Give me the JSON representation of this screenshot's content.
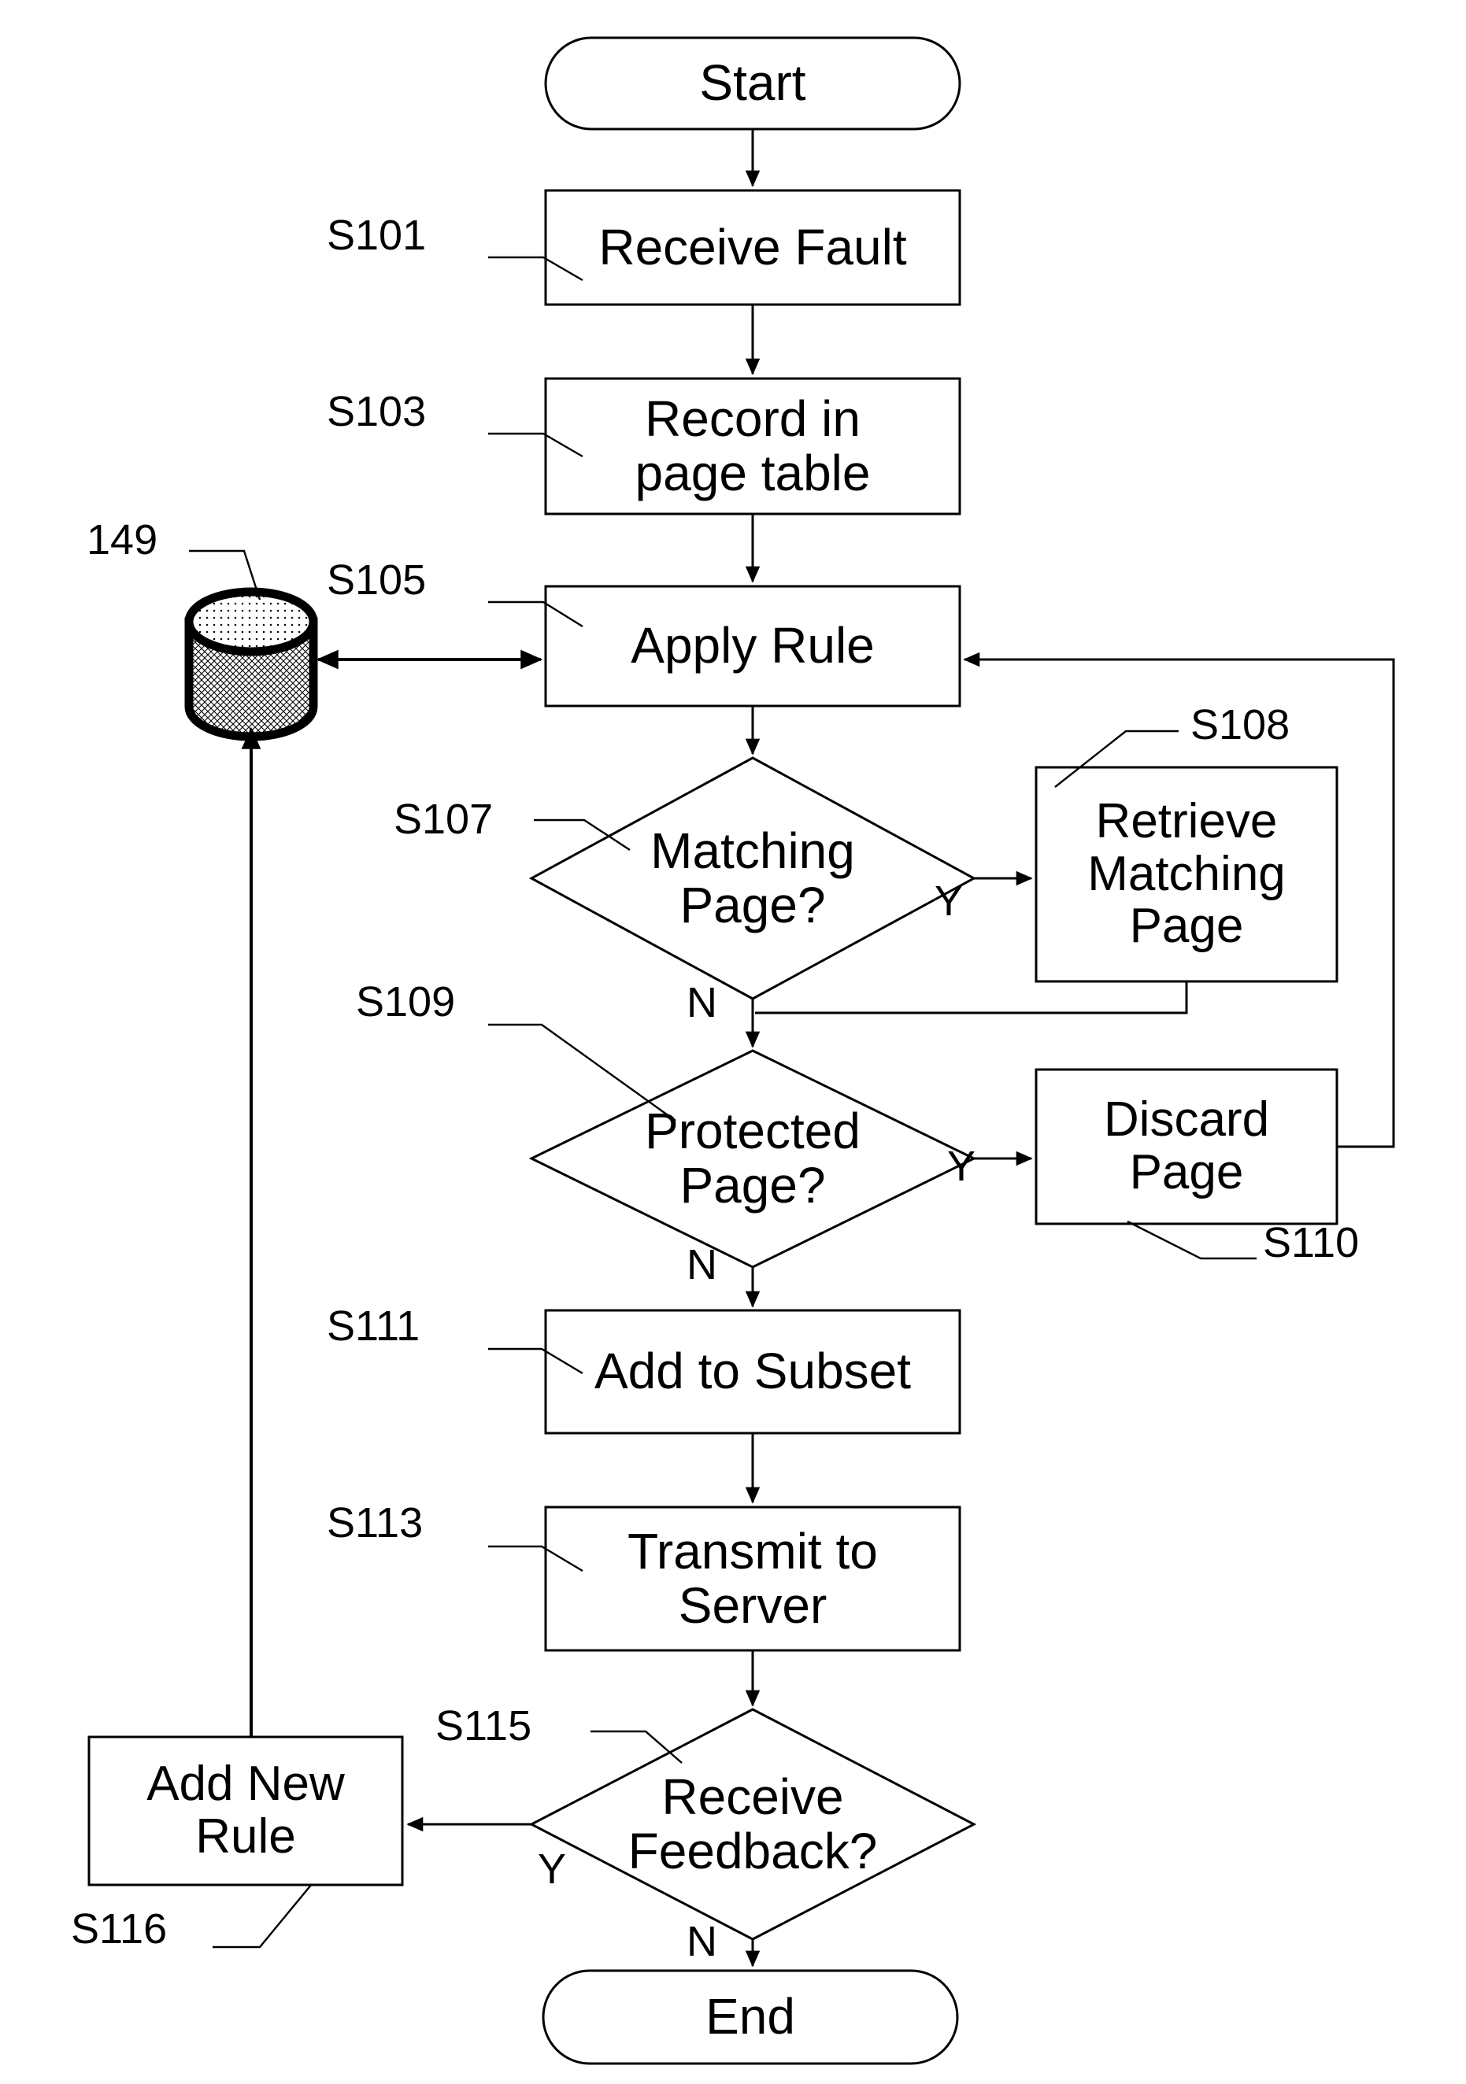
{
  "diagram": {
    "title": "Page fault handling flowchart",
    "stroke_color": "#000000",
    "fill_color": "#ffffff",
    "background": "#ffffff"
  },
  "nodes": {
    "start": {
      "label": "Start",
      "shape": "terminator"
    },
    "receive_fault": {
      "label": "Receive Fault",
      "shape": "process",
      "ref": "S101"
    },
    "record_page_table": {
      "label": "Record in\npage table",
      "shape": "process",
      "ref": "S103"
    },
    "apply_rule": {
      "label": "Apply Rule",
      "shape": "process",
      "ref": "S105"
    },
    "matching_page": {
      "label": "Matching\nPage?",
      "shape": "decision",
      "ref": "S107"
    },
    "retrieve_matching_page": {
      "label": "Retrieve\nMatching\nPage",
      "shape": "process",
      "ref": "S108"
    },
    "protected_page": {
      "label": "Protected\nPage?",
      "shape": "decision",
      "ref": "S109"
    },
    "discard_page": {
      "label": "Discard\nPage",
      "shape": "process",
      "ref": "S110"
    },
    "add_to_subset": {
      "label": "Add to Subset",
      "shape": "process",
      "ref": "S111"
    },
    "transmit_to_server": {
      "label": "Transmit to\nServer",
      "shape": "process",
      "ref": "S113"
    },
    "receive_feedback": {
      "label": "Receive\nFeedback?",
      "shape": "decision",
      "ref": "S115"
    },
    "add_new_rule": {
      "label": "Add New\nRule",
      "shape": "process",
      "ref": "S116"
    },
    "database": {
      "label": "",
      "shape": "cylinder",
      "ref": "149"
    },
    "end": {
      "label": "End",
      "shape": "terminator"
    }
  },
  "reference_labels": {
    "s101": "S101",
    "s103": "S103",
    "s105": "S105",
    "s107": "S107",
    "s108": "S108",
    "s109": "S109",
    "s110": "S110",
    "s111": "S111",
    "s113": "S113",
    "s115": "S115",
    "s116": "S116",
    "db149": "149"
  },
  "branch_labels": {
    "matching_yes": "Y",
    "matching_no": "N",
    "protected_yes": "Y",
    "protected_no": "N",
    "feedback_yes": "Y",
    "feedback_no": "N"
  },
  "edges": [
    {
      "from": "start",
      "to": "receive_fault",
      "label": ""
    },
    {
      "from": "receive_fault",
      "to": "record_page_table",
      "label": ""
    },
    {
      "from": "record_page_table",
      "to": "apply_rule",
      "label": ""
    },
    {
      "from": "database",
      "to": "apply_rule",
      "label": "",
      "bidirectional": true
    },
    {
      "from": "apply_rule",
      "to": "matching_page",
      "label": ""
    },
    {
      "from": "matching_page",
      "to": "retrieve_matching_page",
      "label": "Y"
    },
    {
      "from": "matching_page",
      "to": "protected_page",
      "label": "N"
    },
    {
      "from": "retrieve_matching_page",
      "to": "matching_page_no_path",
      "label": ""
    },
    {
      "from": "protected_page",
      "to": "discard_page",
      "label": "Y"
    },
    {
      "from": "discard_page",
      "to": "apply_rule",
      "label": ""
    },
    {
      "from": "protected_page",
      "to": "add_to_subset",
      "label": "N"
    },
    {
      "from": "add_to_subset",
      "to": "transmit_to_server",
      "label": ""
    },
    {
      "from": "transmit_to_server",
      "to": "receive_feedback",
      "label": ""
    },
    {
      "from": "receive_feedback",
      "to": "add_new_rule",
      "label": "Y"
    },
    {
      "from": "receive_feedback",
      "to": "end",
      "label": "N"
    },
    {
      "from": "add_new_rule",
      "to": "database",
      "label": ""
    }
  ]
}
